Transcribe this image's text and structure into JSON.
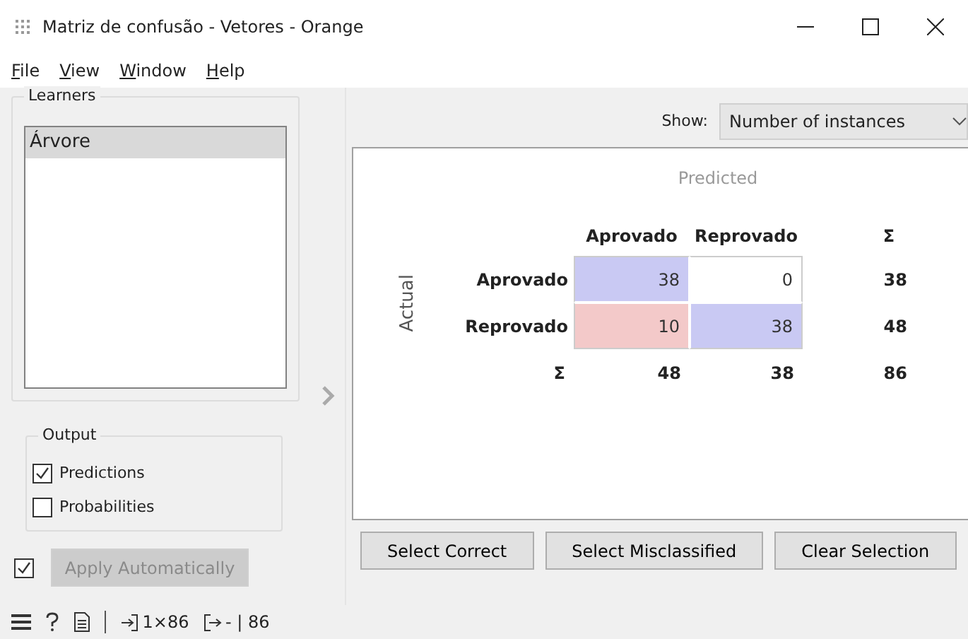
{
  "window": {
    "title": "Matriz de confusão -  Vetores - Orange"
  },
  "menu": [
    "File",
    "View",
    "Window",
    "Help"
  ],
  "learners": {
    "title": "Learners",
    "items": [
      {
        "label": "Árvore",
        "selected": true
      }
    ]
  },
  "output": {
    "title": "Output",
    "options": [
      {
        "label": "Predictions",
        "checked": true
      },
      {
        "label": "Probabilities",
        "checked": false
      }
    ]
  },
  "apply": {
    "label": "Apply Automatically",
    "checked": true,
    "disabled": true
  },
  "show": {
    "label": "Show:",
    "value": "Number of instances"
  },
  "matrix": {
    "predicted_label": "Predicted",
    "actual_label": "Actual",
    "columns": [
      "Aprovado",
      "Reprovado"
    ],
    "sum_column_label": "Σ",
    "rows": [
      {
        "label": "Aprovado",
        "cells": [
          {
            "value": "38",
            "color": "#c9c9f3"
          },
          {
            "value": "0",
            "color": "#ffffff"
          }
        ],
        "sum": "38"
      },
      {
        "label": "Reprovado",
        "cells": [
          {
            "value": "10",
            "color": "#f3c9c9"
          },
          {
            "value": "38",
            "color": "#c9c9f3"
          }
        ],
        "sum": "48"
      }
    ],
    "sum_row_label": "Σ",
    "column_sums": [
      "48",
      "38"
    ],
    "total": "86"
  },
  "buttons": [
    "Select Correct",
    "Select Misclassified",
    "Clear Selection"
  ],
  "status_bar": {
    "input": "1×86",
    "output": "- | 86"
  }
}
